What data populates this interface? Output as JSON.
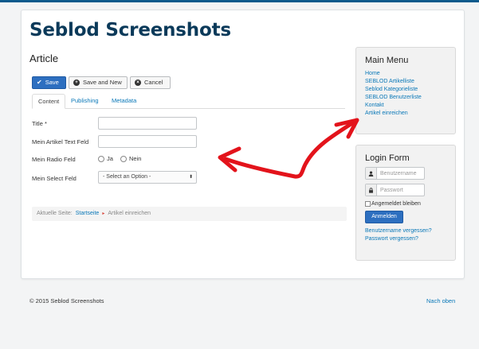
{
  "site": {
    "title": "Seblod Screenshots"
  },
  "article": {
    "title": "Article"
  },
  "toolbar": {
    "save": "Save",
    "save_new": "Save and New",
    "cancel": "Cancel"
  },
  "tabs": [
    "Content",
    "Publishing",
    "Metadata"
  ],
  "form": {
    "title_label": "Title *",
    "text_label": "Mein Artikel Text Feld",
    "radio_label": "Mein Radio Feld",
    "radio_options": [
      "Ja",
      "Nein"
    ],
    "select_label": "Mein Select Feld",
    "select_value": "- Select an Option -"
  },
  "breadcrumb": {
    "prefix": "Aktuelle Seite:",
    "home": "Startseite",
    "current": "Artikel einreichen"
  },
  "main_menu": {
    "title": "Main Menu",
    "items": [
      "Home",
      "SEBLOD Artikelliste",
      "Seblod Kategorieliste",
      "SEBLOD Benutzerliste",
      "Kontakt",
      "Artikel einreichen"
    ]
  },
  "login": {
    "title": "Login Form",
    "username_placeholder": "Benutzername",
    "password_placeholder": "Passwort",
    "remember": "Angemeldet bleiben",
    "submit": "Anmelden",
    "forgot_username": "Benutzername vergessen?",
    "forgot_password": "Passwort vergessen?"
  },
  "footer": {
    "copyright": "© 2015 Seblod Screenshots",
    "top_link": "Nach oben"
  },
  "colors": {
    "brand": "#0b3a5a",
    "link": "#0a78b8",
    "primary_button": "#2d6fc0",
    "annotation_arrow": "#e3131b"
  },
  "icons": {
    "save": "checkmark-icon",
    "save_new": "plus-circle-icon",
    "cancel": "x-circle-icon",
    "user": "user-icon",
    "password": "lock-icon"
  }
}
